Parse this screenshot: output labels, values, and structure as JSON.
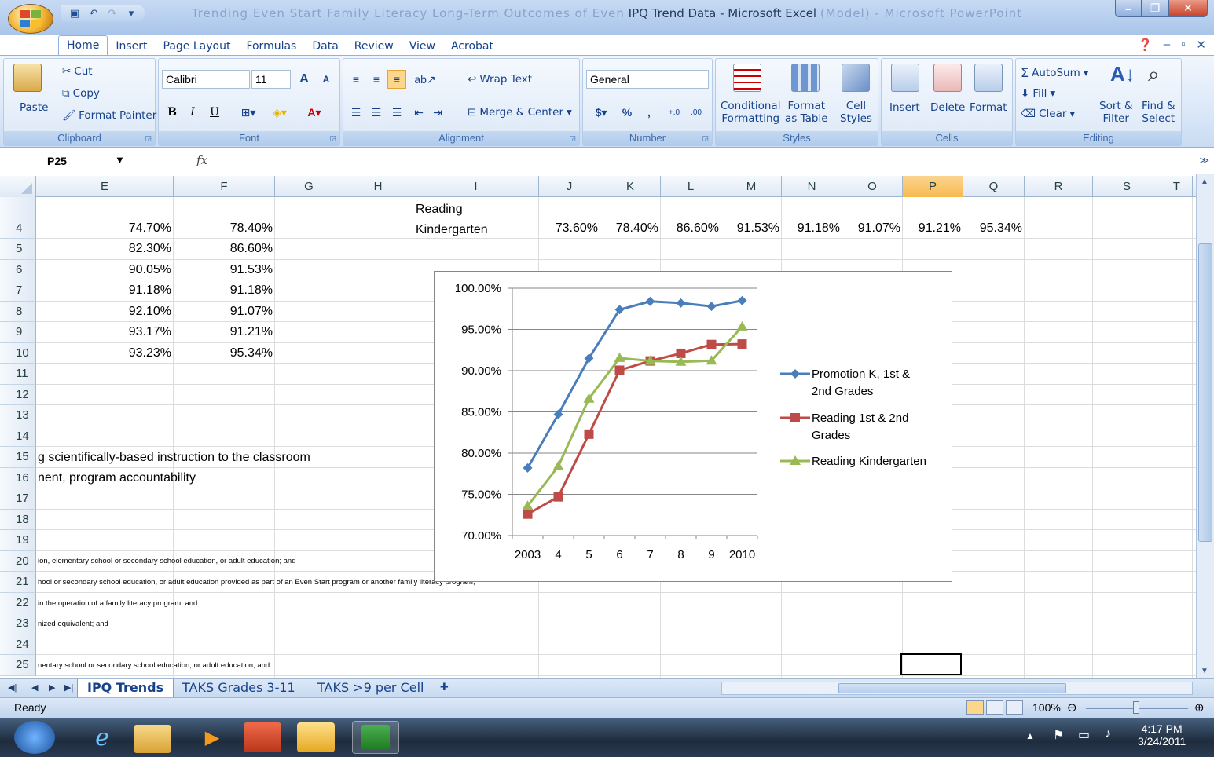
{
  "window": {
    "title": "IPQ Trend Data - Microsoft Excel",
    "ghost_title": "Trending Even Start Family Literacy Long-Term Outcomes of Even",
    "ghost_right": "(Model) - Microsoft PowerPoint"
  },
  "tabs": [
    "Home",
    "Insert",
    "Page Layout",
    "Formulas",
    "Data",
    "Review",
    "View",
    "Acrobat"
  ],
  "ribbon": {
    "clipboard": {
      "paste": "Paste",
      "cut": "Cut",
      "copy": "Copy",
      "format_painter": "Format Painter",
      "label": "Clipboard"
    },
    "font": {
      "name": "Calibri",
      "size": "11",
      "bold": "B",
      "italic": "I",
      "underline": "U",
      "label": "Font",
      "grow": "A",
      "shrink": "A"
    },
    "alignment": {
      "wrap": "Wrap Text",
      "merge": "Merge & Center",
      "label": "Alignment"
    },
    "number": {
      "format": "General",
      "currency": "$",
      "percent": "%",
      "comma": ",",
      "inc_dec": ".00",
      "label": "Number"
    },
    "styles": {
      "cond_line1": "Conditional",
      "cond_line2": "Formatting",
      "table_line1": "Format",
      "table_line2": "as Table",
      "cell_line1": "Cell",
      "cell_line2": "Styles",
      "label": "Styles"
    },
    "cells": {
      "insert": "Insert",
      "delete": "Delete",
      "format": "Format",
      "label": "Cells"
    },
    "editing": {
      "autosum": "AutoSum",
      "fill": "Fill",
      "clear": "Clear",
      "sort_line1": "Sort &",
      "sort_line2": "Filter",
      "find_line1": "Find &",
      "find_line2": "Select",
      "label": "Editing"
    }
  },
  "formula_bar": {
    "name_box": "P25",
    "fx": "fx",
    "value": ""
  },
  "columns": [
    {
      "name": "E",
      "sel": false
    },
    {
      "name": "F",
      "sel": false
    },
    {
      "name": "G",
      "sel": false
    },
    {
      "name": "H",
      "sel": false
    },
    {
      "name": "I",
      "sel": false
    },
    {
      "name": "J",
      "sel": false
    },
    {
      "name": "K",
      "sel": false
    },
    {
      "name": "L",
      "sel": false
    },
    {
      "name": "M",
      "sel": false
    },
    {
      "name": "N",
      "sel": false
    },
    {
      "name": "O",
      "sel": false
    },
    {
      "name": "P",
      "sel": true
    },
    {
      "name": "Q",
      "sel": false
    },
    {
      "name": "R",
      "sel": false
    },
    {
      "name": "S",
      "sel": false
    },
    {
      "name": "T",
      "sel": false
    }
  ],
  "rows": [
    "4",
    "5",
    "6",
    "7",
    "8",
    "9",
    "10",
    "11",
    "12",
    "13",
    "14",
    "15",
    "16",
    "17",
    "18",
    "19",
    "20",
    "21",
    "22",
    "23",
    "24",
    "25"
  ],
  "cells": {
    "I_reading": "Reading",
    "I4": "Kindergarten",
    "E": [
      "74.70%",
      "82.30%",
      "90.05%",
      "91.18%",
      "92.10%",
      "93.17%",
      "93.23%"
    ],
    "F": [
      "78.40%",
      "86.60%",
      "91.53%",
      "91.18%",
      "91.07%",
      "91.21%",
      "95.34%"
    ],
    "row4_right": [
      "73.60%",
      "78.40%",
      "86.60%",
      "91.53%",
      "91.18%",
      "91.07%",
      "91.21%",
      "95.34%"
    ],
    "r15": "g scientifically-based instruction to the classroom",
    "r16": "nent, program accountability",
    "r20": "ion, elementary school or secondary school education, or adult education; and",
    "r21": "hool or secondary school education, or adult education provided as part of an Even Start program or another family literacy program;",
    "r22": "in the operation of a family literacy program; and",
    "r23": "nized equivalent; and",
    "r25": "nentary school or secondary school education, or adult education; and"
  },
  "chart_data": {
    "type": "line",
    "categories": [
      "2003",
      "4",
      "5",
      "6",
      "7",
      "8",
      "9",
      "2010"
    ],
    "ylim": [
      70,
      100
    ],
    "yticks": [
      "70.00%",
      "75.00%",
      "80.00%",
      "85.00%",
      "90.00%",
      "95.00%",
      "100.00%"
    ],
    "series": [
      {
        "name": "Promotion K, 1st & 2nd Grades",
        "name_line1": "Promotion K, 1st &",
        "name_line2": "2nd Grades",
        "color": "#4a7ebb",
        "marker": "diamond",
        "values": [
          78.2,
          84.7,
          91.5,
          97.4,
          98.4,
          98.2,
          97.8,
          98.5
        ]
      },
      {
        "name": "Reading 1st & 2nd Grades",
        "name_line1": "Reading 1st & 2nd",
        "name_line2": "Grades",
        "color": "#be4b48",
        "marker": "square",
        "values": [
          72.6,
          74.7,
          82.3,
          90.05,
          91.18,
          92.1,
          93.17,
          93.23
        ]
      },
      {
        "name": "Reading Kindergarten",
        "name_line1": "Reading Kindergarten",
        "name_line2": "",
        "color": "#98b954",
        "marker": "triangle",
        "values": [
          73.6,
          78.4,
          86.6,
          91.53,
          91.18,
          91.07,
          91.21,
          95.34
        ]
      }
    ],
    "legend": "right",
    "grid": true
  },
  "sheets": [
    {
      "name": "IPQ Trends",
      "active": true
    },
    {
      "name": "TAKS Grades 3-11",
      "active": false
    },
    {
      "name": "TAKS >9 per Cell",
      "active": false
    }
  ],
  "status": {
    "text": "Ready",
    "zoom": "100%"
  },
  "taskbar": {
    "time": "4:17 PM",
    "date": "3/24/2011"
  }
}
